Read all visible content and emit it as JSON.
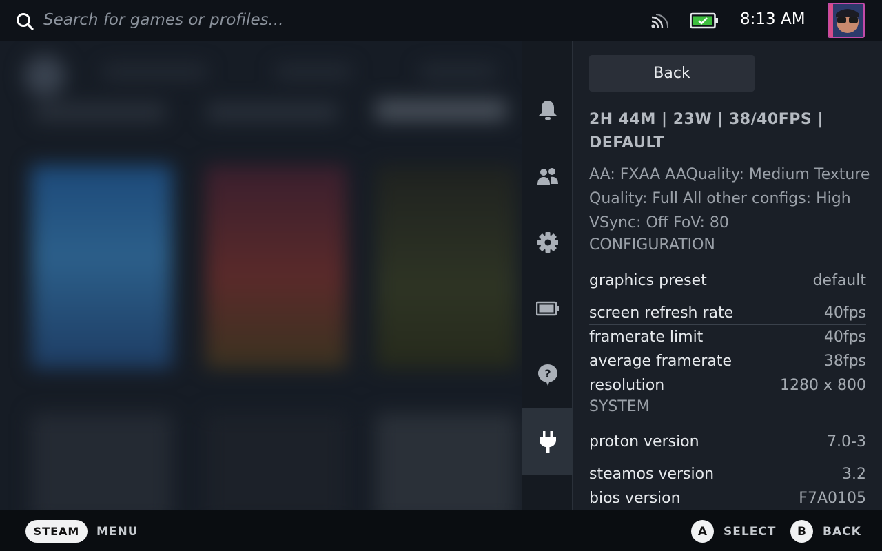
{
  "topbar": {
    "search_placeholder": "Search for games or profiles...",
    "clock": "8:13 AM",
    "icons": [
      "search-icon",
      "cast-icon",
      "battery-icon",
      "avatar"
    ]
  },
  "rail": {
    "items": [
      {
        "icon": "bell-icon"
      },
      {
        "icon": "friends-icon"
      },
      {
        "icon": "gear-icon"
      },
      {
        "icon": "battery-icon"
      },
      {
        "icon": "help-icon"
      },
      {
        "icon": "plug-icon",
        "active": true
      }
    ]
  },
  "panel": {
    "back_label": "Back",
    "summary": "2H 44M | 23W | 38/40FPS | DEFAULT",
    "description": "AA: FXAA AAQuality: Medium Texture Quality: Full All other configs: High VSync: Off FoV: 80",
    "configuration": {
      "title": "CONFIGURATION",
      "rows": [
        {
          "key": "graphics preset",
          "value": "default"
        },
        {
          "key": "screen refresh rate",
          "value": "40fps"
        },
        {
          "key": "framerate limit",
          "value": "40fps"
        },
        {
          "key": "average framerate",
          "value": "38fps"
        },
        {
          "key": "resolution",
          "value": "1280 x 800"
        }
      ]
    },
    "system": {
      "title": "SYSTEM",
      "rows": [
        {
          "key": "proton version",
          "value": "7.0-3"
        },
        {
          "key": "steamos version",
          "value": "3.2"
        },
        {
          "key": "bios version",
          "value": "F7A0105"
        }
      ]
    }
  },
  "bottombar": {
    "steam_label": "STEAM",
    "menu_label": "MENU",
    "a_glyph": "A",
    "select_label": "SELECT",
    "b_glyph": "B",
    "back_label": "BACK"
  },
  "colors": {
    "panel_bg": "#1a1f27",
    "rail_bg": "#151a21",
    "battery_fill": "#3fbf3f"
  }
}
